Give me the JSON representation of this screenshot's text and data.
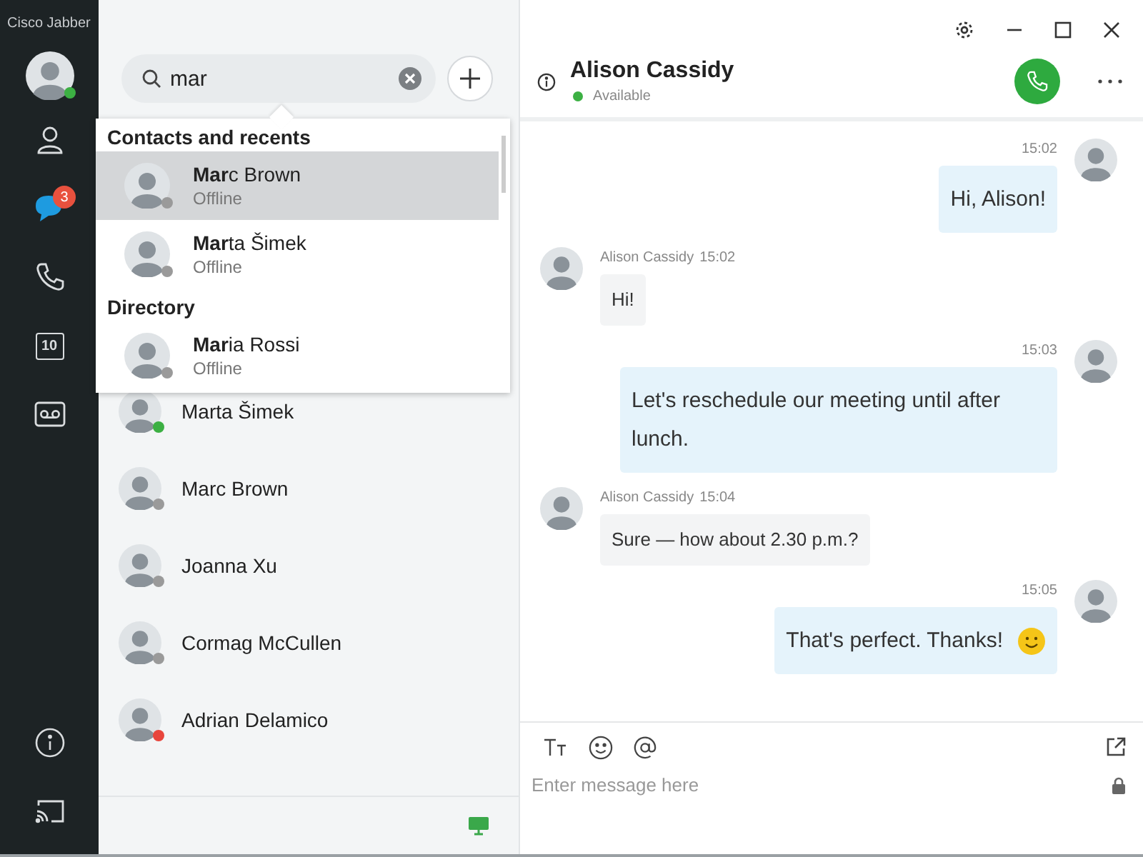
{
  "app": {
    "title": "Cisco Jabber"
  },
  "nav": [
    {
      "kind": "contacts",
      "selected": false
    },
    {
      "kind": "chats",
      "selected": true,
      "badge": "3"
    },
    {
      "kind": "calls",
      "selected": false
    },
    {
      "kind": "meetings",
      "selected": false,
      "day": "10"
    },
    {
      "kind": "voicemail",
      "selected": false
    }
  ],
  "search": {
    "value": "mar"
  },
  "search_results": {
    "sections": [
      {
        "title": "Contacts and recents",
        "items": [
          {
            "name": "**Mar**c Brown",
            "status": "Offline",
            "color": "#9a9a9a",
            "selected": true
          },
          {
            "name": "**Mar**ta Šimek",
            "status": "Offline",
            "color": "#9a9a9a",
            "selected": false
          }
        ]
      },
      {
        "title": "Directory",
        "items": [
          {
            "name": "**Mar**ia Rossi",
            "status": "Offline",
            "color": "#9a9a9a",
            "selected": false
          }
        ]
      }
    ]
  },
  "contacts": [
    {
      "name": "Marta Šimek",
      "color": "#3cb043"
    },
    {
      "name": "Marc Brown",
      "color": "#9a9a9a"
    },
    {
      "name": "Joanna Xu",
      "color": "#9a9a9a"
    },
    {
      "name": "Cormag McCullen",
      "color": "#9a9a9a"
    },
    {
      "name": "Adrian Delamico",
      "color": "#e8453c"
    }
  ],
  "chat": {
    "name": "Alison Cassidy",
    "status": "Available"
  },
  "messages": [
    {
      "kind": "sent",
      "time": "15:02",
      "text": "Hi, Alison!",
      "emoji": false
    },
    {
      "kind": "received",
      "sender": "Alison Cassidy",
      "time": "15:02",
      "text": "Hi!",
      "emoji": false
    },
    {
      "kind": "sent",
      "time": "15:03",
      "text": "Let's reschedule our meeting until after lunch.",
      "emoji": false
    },
    {
      "kind": "received",
      "sender": "Alison Cassidy",
      "time": "15:04",
      "text": "Sure — how about 2.30 p.m.?",
      "emoji": false
    },
    {
      "kind": "sent",
      "time": "15:05",
      "text": "That's perfect. Thanks!",
      "emoji": true
    }
  ],
  "composer": {
    "placeholder": "Enter message here"
  }
}
